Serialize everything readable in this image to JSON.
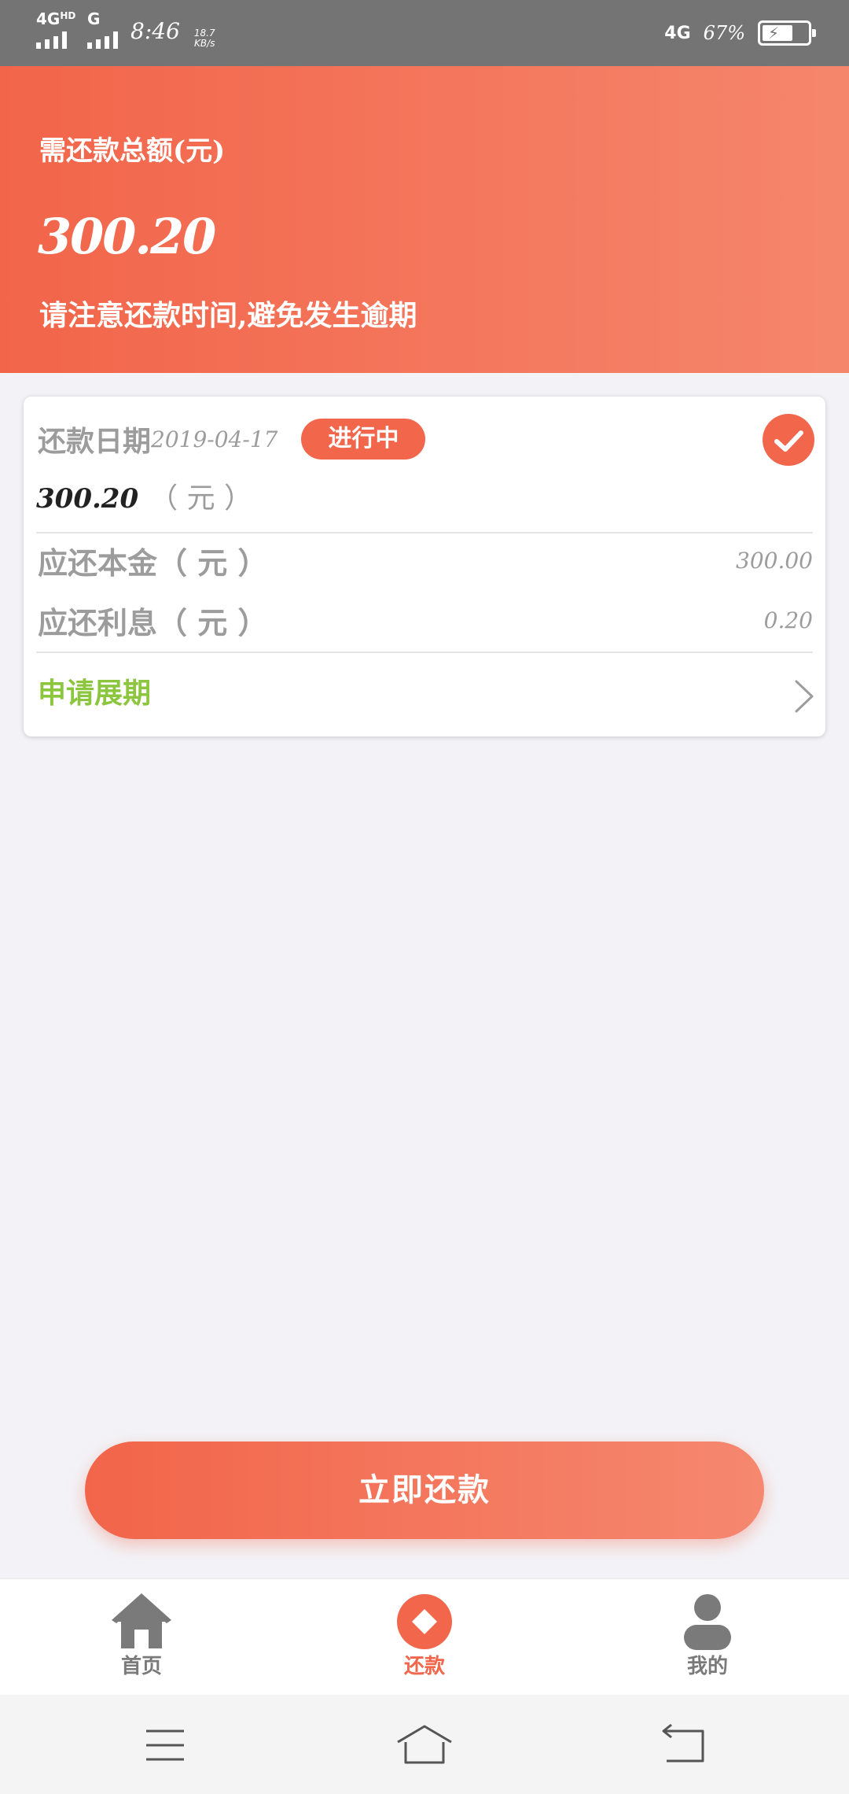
{
  "status_bar": {
    "network_left_1": "4G",
    "network_left_1_sup": "HD",
    "network_left_2": "G",
    "time": "8:46",
    "speed_value": "18.7",
    "speed_unit": "KB/s",
    "network_right": "4G",
    "battery_percent": "67%",
    "battery_level": 0.67
  },
  "header": {
    "title": "需还款总额(元)",
    "amount": "300.20",
    "notice": "请注意还款时间,避免发生逾期"
  },
  "card": {
    "date_label": "还款日期",
    "date_value": "2019-04-17",
    "status_badge": "进行中",
    "due_amount": "300.20",
    "due_unit": "（ 元 ）",
    "principal_label": "应还本金（ 元 ）",
    "principal_value": "300.00",
    "interest_label": "应还利息（ 元 ）",
    "interest_value": "0.20",
    "extend_label": "申请展期"
  },
  "repay_button": "立即还款",
  "bottom_nav": {
    "items": [
      {
        "label": "首页",
        "icon": "home-icon"
      },
      {
        "label": "还款",
        "icon": "repay-icon",
        "active": true
      },
      {
        "label": "我的",
        "icon": "profile-icon"
      }
    ]
  },
  "colors": {
    "accent": "#f2664b",
    "extend_green": "#8cc63f",
    "status_bar_bg": "#747474",
    "page_bg": "#f3f3f7"
  }
}
